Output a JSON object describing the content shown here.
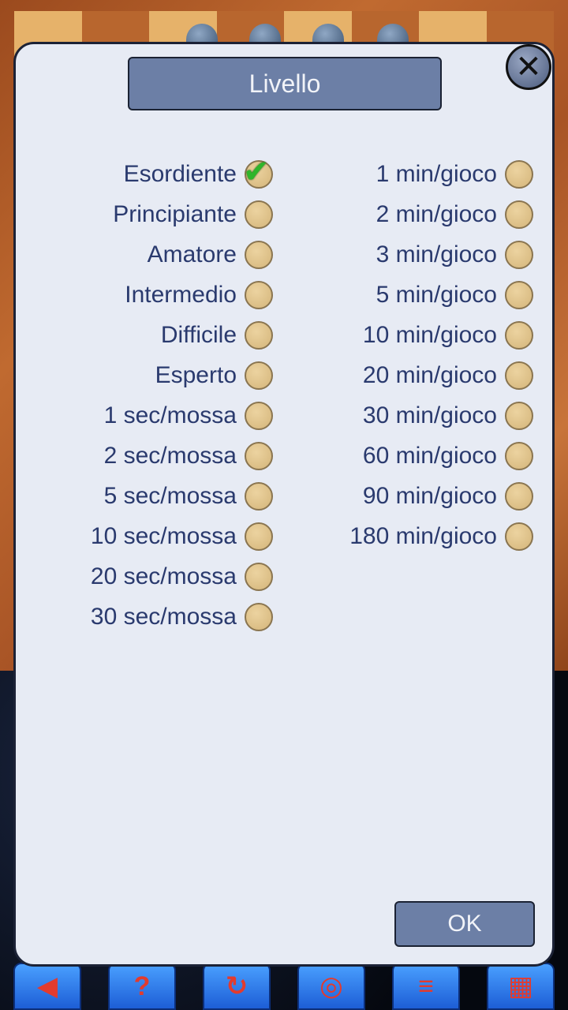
{
  "dialog": {
    "title": "Livello",
    "ok_label": "OK",
    "selected_level": "Esordiente"
  },
  "left_options": [
    {
      "label": "Esordiente",
      "selected": true
    },
    {
      "label": "Principiante",
      "selected": false
    },
    {
      "label": "Amatore",
      "selected": false
    },
    {
      "label": "Intermedio",
      "selected": false
    },
    {
      "label": "Difficile",
      "selected": false
    },
    {
      "label": "Esperto",
      "selected": false
    },
    {
      "label": "1 sec/mossa",
      "selected": false
    },
    {
      "label": "2 sec/mossa",
      "selected": false
    },
    {
      "label": "5 sec/mossa",
      "selected": false
    },
    {
      "label": "10 sec/mossa",
      "selected": false
    },
    {
      "label": "20 sec/mossa",
      "selected": false
    },
    {
      "label": "30 sec/mossa",
      "selected": false
    }
  ],
  "right_options": [
    {
      "label": "1 min/gioco",
      "selected": false
    },
    {
      "label": "2 min/gioco",
      "selected": false
    },
    {
      "label": "3 min/gioco",
      "selected": false
    },
    {
      "label": "5 min/gioco",
      "selected": false
    },
    {
      "label": "10 min/gioco",
      "selected": false
    },
    {
      "label": "20 min/gioco",
      "selected": false
    },
    {
      "label": "30 min/gioco",
      "selected": false
    },
    {
      "label": "60 min/gioco",
      "selected": false
    },
    {
      "label": "90 min/gioco",
      "selected": false
    },
    {
      "label": "180 min/gioco",
      "selected": false
    }
  ],
  "toolbar": {
    "icons": [
      "back-arrow-icon",
      "help-icon",
      "rotate-icon",
      "target-icon",
      "menu-icon",
      "board-icon"
    ]
  },
  "colors": {
    "dialog_bg": "#e7ebf4",
    "button_bg": "#6c7fa6",
    "label_text": "#2a3a6e",
    "radio": "#d4b57a",
    "check": "#2fb52a"
  }
}
